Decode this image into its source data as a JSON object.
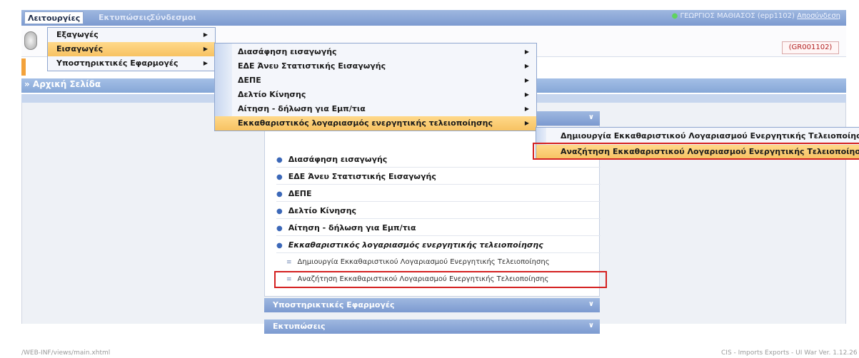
{
  "topbar": {
    "menus": [
      "Λειτουργίες",
      "Εκτυπώσεις",
      "Σύνδεσμοι"
    ],
    "user": "ΓΕΩΡΓΙΟΣ ΜΑΘΙΑΣΟΣ (epp1102)",
    "logout": "Αποσύνδεση"
  },
  "header": {
    "code": "(GR001102)"
  },
  "breadcrumb": "» Αρχική Σελίδα",
  "menu_level1": [
    {
      "label": "Εξαγωγές",
      "highlighted": false
    },
    {
      "label": "Εισαγωγές",
      "highlighted": true
    },
    {
      "label": "Υποστηρικτικές Εφαρμογές",
      "highlighted": false
    }
  ],
  "menu_level2": [
    {
      "label": "Διασάφηση εισαγωγής"
    },
    {
      "label": "ΕΔΕ Άνευ Στατιστικής Εισαγωγής"
    },
    {
      "label": "ΔΕΠΕ"
    },
    {
      "label": "Δελτίο Κίνησης"
    },
    {
      "label": "Αίτηση - δήλωση για Εμπ/τια"
    },
    {
      "label": "Εκκαθαριστικός λογαριασμός ενεργητικής τελειοποίησης",
      "highlighted": true
    }
  ],
  "menu_level3": [
    {
      "label": "Δημιουργία Εκκαθαριστικού Λογαριασμού Ενεργητικής Τελειοποίησης"
    },
    {
      "label": "Αναζήτηση Εκκαθαριστικού Λογαριασμού Ενεργητικής Τελειοποίησης",
      "highlighted": true
    }
  ],
  "panel": {
    "items": [
      "Διασάφηση εισαγωγής",
      "ΕΔΕ Άνευ Στατιστικής Εισαγωγής",
      "ΔΕΠΕ",
      "Δελτίο Κίνησης",
      "Αίτηση - δήλωση για Εμπ/τια",
      "Εκκαθαριστικός λογαριασμός ενεργητικής τελειοποίησης"
    ],
    "subitems": [
      "Δημιουργία Εκκαθαριστικού Λογαριασμού Ενεργητικής Τελειοποίησης",
      "Αναζήτηση Εκκαθαριστικού Λογαριασμού Ενεργητικής Τελειοποίησης"
    ],
    "sections": [
      "Υποστηρικτικές Εφαρμογές",
      "Εκτυπώσεις"
    ]
  },
  "footer": {
    "path": "/WEB-INF/views/main.xhtml",
    "version": "CIS - Imports Exports - UI War Ver. 1.12.26"
  },
  "colors": {
    "highlight": "#f7c262",
    "accent": "#7c9ad0",
    "annotation": "#d42020"
  }
}
